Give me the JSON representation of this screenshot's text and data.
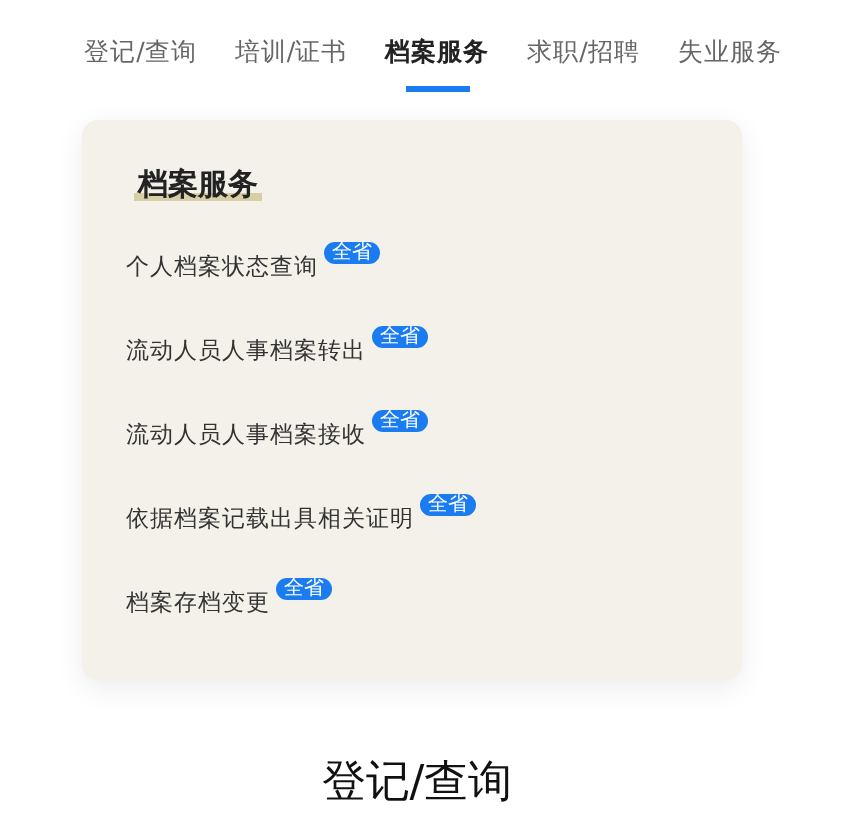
{
  "tabs": [
    {
      "label": "登记/查询",
      "selected": false
    },
    {
      "label": "培训/证书",
      "selected": false
    },
    {
      "label": "档案服务",
      "selected": true
    },
    {
      "label": "求职/招聘",
      "selected": false
    },
    {
      "label": "失业服务",
      "selected": false
    }
  ],
  "panel": {
    "title": "档案服务",
    "items": [
      {
        "label": "个人档案状态查询",
        "badge": "全省"
      },
      {
        "label": "流动人员人事档案转出",
        "badge": "全省"
      },
      {
        "label": "流动人员人事档案接收",
        "badge": "全省"
      },
      {
        "label": "依据档案记载出具相关证明",
        "badge": "全省"
      },
      {
        "label": "档案存档变更",
        "badge": "全省"
      }
    ]
  },
  "section_heading": "登记/查询"
}
